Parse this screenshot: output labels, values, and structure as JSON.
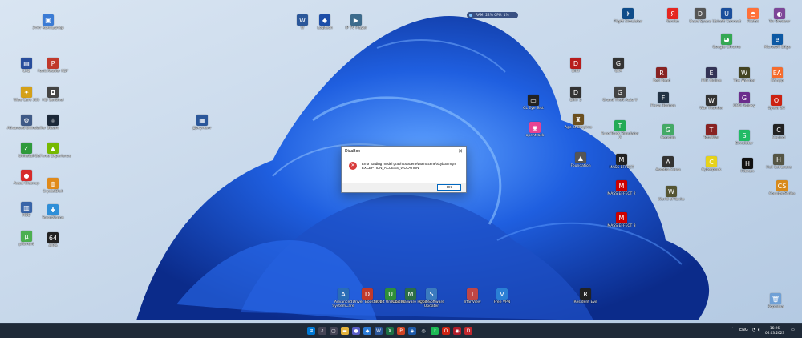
{
  "desktop": {
    "icons": [
      {
        "id": "net",
        "label": "Этот компьютер",
        "color": "#3a7bd5",
        "glyph": "▣"
      },
      {
        "id": "word",
        "label": "W",
        "color": "#2b579a",
        "glyph": "W"
      },
      {
        "id": "logitech",
        "label": "Logitech",
        "color": "#1d4ea8",
        "glyph": "◆"
      },
      {
        "id": "ip",
        "label": "IP TV Player",
        "color": "#3d6b8c",
        "glyph": "▶"
      },
      {
        "id": "cr2",
        "label": "CR2",
        "color": "#284d9c",
        "glyph": "▤"
      },
      {
        "id": "foxit",
        "label": "Foxit Reader PDF",
        "color": "#c0392b",
        "glyph": "P"
      },
      {
        "id": "wise",
        "label": "Wise Care 365",
        "color": "#d4a017",
        "glyph": "✦"
      },
      {
        "id": "hd",
        "label": "HD Sentinel",
        "color": "#444",
        "glyph": "◘"
      },
      {
        "id": "admin",
        "label": "Advanced Uninstaller",
        "color": "#3f5a87",
        "glyph": "⚙"
      },
      {
        "id": "steam",
        "label": "Steam",
        "color": "#1b2838",
        "glyph": "◎"
      },
      {
        "id": "uninstall",
        "label": "Uninstall",
        "color": "#2f9a3c",
        "glyph": "✓"
      },
      {
        "id": "geforce",
        "label": "GeForce Experience",
        "color": "#76b900",
        "glyph": "▲"
      },
      {
        "id": "avast",
        "label": "Avast Cleanup",
        "color": "#d62b2b",
        "glyph": "●"
      },
      {
        "id": "crystal",
        "label": "CrystalDisk",
        "color": "#e08a1b",
        "glyph": "◍"
      },
      {
        "id": "hdd",
        "label": "HDD",
        "color": "#3864a8",
        "glyph": "▥"
      },
      {
        "id": "smart",
        "label": "SmartGame",
        "color": "#2f8fd8",
        "glyph": "✚"
      },
      {
        "id": "utorrent",
        "label": "µTorrent",
        "color": "#4caf50",
        "glyph": "µ"
      },
      {
        "id": "aida",
        "label": "AIDA",
        "color": "#222",
        "glyph": "64"
      },
      {
        "id": "doc",
        "label": "Документ",
        "color": "#2b579a",
        "glyph": "▦"
      },
      {
        "id": "cl",
        "label": "CL Eye Test",
        "color": "#222",
        "glyph": "▭"
      },
      {
        "id": "opentrack",
        "label": "opentrack",
        "color": "#e84393",
        "glyph": "◉"
      },
      {
        "id": "dirt",
        "label": "DiRT",
        "color": "#b71c1c",
        "glyph": "D"
      },
      {
        "id": "dirt2",
        "label": "DiRT 5",
        "color": "#333",
        "glyph": "D"
      },
      {
        "id": "aoe",
        "label": "Age of Empires",
        "color": "#6b4f1e",
        "glyph": "♜"
      },
      {
        "id": "found",
        "label": "Foundation",
        "color": "#555",
        "glyph": "▲"
      },
      {
        "id": "gta1",
        "label": "GTA",
        "color": "#333",
        "glyph": "G"
      },
      {
        "id": "gta2",
        "label": "Grand Theft Auto V",
        "color": "#444",
        "glyph": "G"
      },
      {
        "id": "rdr",
        "label": "Red Dead",
        "color": "#822",
        "glyph": "R"
      },
      {
        "id": "fh",
        "label": "Forza Horizon",
        "color": "#234",
        "glyph": "F"
      },
      {
        "id": "ets",
        "label": "Euro Truck Simulator 2",
        "color": "#2a5",
        "glyph": "T"
      },
      {
        "id": "me1",
        "label": "MASS EFFECT",
        "color": "#222",
        "glyph": "M"
      },
      {
        "id": "me2",
        "label": "MASS EFFECT 2",
        "color": "#c00",
        "glyph": "M"
      },
      {
        "id": "me3",
        "label": "MASS EFFECT 3",
        "color": "#c00",
        "glyph": "M"
      },
      {
        "id": "gen",
        "label": "Genshin",
        "color": "#4a6",
        "glyph": "G"
      },
      {
        "id": "ac",
        "label": "Assetto Corsa",
        "color": "#333",
        "glyph": "A"
      },
      {
        "id": "wot",
        "label": "World of Tanks",
        "color": "#553",
        "glyph": "W"
      },
      {
        "id": "tw",
        "label": "TotalWar",
        "color": "#822",
        "glyph": "T"
      },
      {
        "id": "cyber",
        "label": "Cyberpunk",
        "color": "#e6d21a",
        "glyph": "C"
      },
      {
        "id": "sim",
        "label": "Simulator",
        "color": "#2b6",
        "glyph": "S"
      },
      {
        "id": "yandex",
        "label": "Yandex",
        "color": "#e52620",
        "glyph": "Я"
      },
      {
        "id": "chrome",
        "label": "Google Chrome",
        "color": "#34a853",
        "glyph": "◕"
      },
      {
        "id": "firefox",
        "label": "Firefox",
        "color": "#ff7139",
        "glyph": "◓"
      },
      {
        "id": "edge",
        "label": "Microsoft Edge",
        "color": "#0c59a4",
        "glyph": "e"
      },
      {
        "id": "opera",
        "label": "Opera GX",
        "color": "#c21",
        "glyph": "O"
      },
      {
        "id": "tor",
        "label": "Tor Browser",
        "color": "#7d4698",
        "glyph": "◐"
      },
      {
        "id": "eve",
        "label": "EVE Online",
        "color": "#335",
        "glyph": "E"
      },
      {
        "id": "wt",
        "label": "War Thunder",
        "color": "#333",
        "glyph": "W"
      },
      {
        "id": "witcher",
        "label": "The Witcher",
        "color": "#442",
        "glyph": "W"
      },
      {
        "id": "uplay",
        "label": "Ubisoft Connect",
        "color": "#1b4f9c",
        "glyph": "U"
      },
      {
        "id": "gog",
        "label": "GOG Galaxy",
        "color": "#6b2d8c",
        "glyph": "G"
      },
      {
        "id": "origin",
        "label": "EA app",
        "color": "#f56c2d",
        "glyph": "EA"
      },
      {
        "id": "hitman",
        "label": "Hitman",
        "color": "#111",
        "glyph": "H"
      },
      {
        "id": "control",
        "label": "Control",
        "color": "#222",
        "glyph": "C"
      },
      {
        "id": "hll",
        "label": "Hell Let Loose",
        "color": "#554",
        "glyph": "H"
      },
      {
        "id": "cs",
        "label": "Counter-Strike",
        "color": "#d88a1a",
        "glyph": "CS"
      },
      {
        "id": "ds",
        "label": "Dead Space",
        "color": "#555",
        "glyph": "D"
      },
      {
        "id": "msfs",
        "label": "Flight Simulator",
        "color": "#0e4c8a",
        "glyph": "✈"
      },
      {
        "id": "re",
        "label": "Resident Evil",
        "color": "#222",
        "glyph": "R"
      },
      {
        "id": "bin",
        "label": "Корзина",
        "color": "#6fa0d6",
        "glyph": "🗑"
      },
      {
        "id": "asc",
        "label": "Advanced SystemCare",
        "color": "#2a6db5",
        "glyph": "A"
      },
      {
        "id": "driver",
        "label": "Driver Booster 9",
        "color": "#c0392b",
        "glyph": "D"
      },
      {
        "id": "unl1",
        "label": "IObit Uninstaller",
        "color": "#2f8f3a",
        "glyph": "U"
      },
      {
        "id": "unl2",
        "label": "IObit Malware Fighter",
        "color": "#2c6e46",
        "glyph": "M"
      },
      {
        "id": "iobit",
        "label": "IObit Software Updater",
        "color": "#3b7bbf",
        "glyph": "S"
      },
      {
        "id": "irfan",
        "label": "IrfanView",
        "color": "#c04646",
        "glyph": "I"
      },
      {
        "id": "vpn",
        "label": "Free VPN",
        "color": "#2a7fd5",
        "glyph": "V"
      }
    ]
  },
  "dialog": {
    "title": "DiaaBox",
    "message": "Error loading model graphics\\scene\\MainScene\\skybox.mgm EXCEPTION_ACCESS_VIOLATION",
    "ok_label": "OK",
    "close_glyph": "✕"
  },
  "sysmon": {
    "text": "RAM: 22%   CPU: 1%"
  },
  "taskbar": {
    "apps": [
      {
        "name": "start",
        "glyph": "⊞",
        "color": "#0078d4"
      },
      {
        "name": "search",
        "glyph": "⌕",
        "color": "#445"
      },
      {
        "name": "taskview",
        "glyph": "▢",
        "color": "#445"
      },
      {
        "name": "explorer",
        "glyph": "▬",
        "color": "#e3b23c"
      },
      {
        "name": "chat",
        "glyph": "●",
        "color": "#5b5fc7"
      },
      {
        "name": "app-blue",
        "glyph": "◆",
        "color": "#2b7bd6"
      },
      {
        "name": "word",
        "glyph": "W",
        "color": "#2b579a"
      },
      {
        "name": "excel",
        "glyph": "X",
        "color": "#1d7044"
      },
      {
        "name": "office",
        "glyph": "P",
        "color": "#d04423"
      },
      {
        "name": "defender",
        "glyph": "◈",
        "color": "#1e5aa8"
      },
      {
        "name": "steam",
        "glyph": "◎",
        "color": "#1b2838"
      },
      {
        "name": "music",
        "glyph": "♪",
        "color": "#1db954"
      },
      {
        "name": "opera",
        "glyph": "O",
        "color": "#c21"
      },
      {
        "name": "app-red",
        "glyph": "◉",
        "color": "#b01d2a"
      },
      {
        "name": "game-red",
        "glyph": "D",
        "color": "#c0272d"
      }
    ],
    "lang": "ENG",
    "time": "16:26",
    "date": "06.03.2023"
  }
}
